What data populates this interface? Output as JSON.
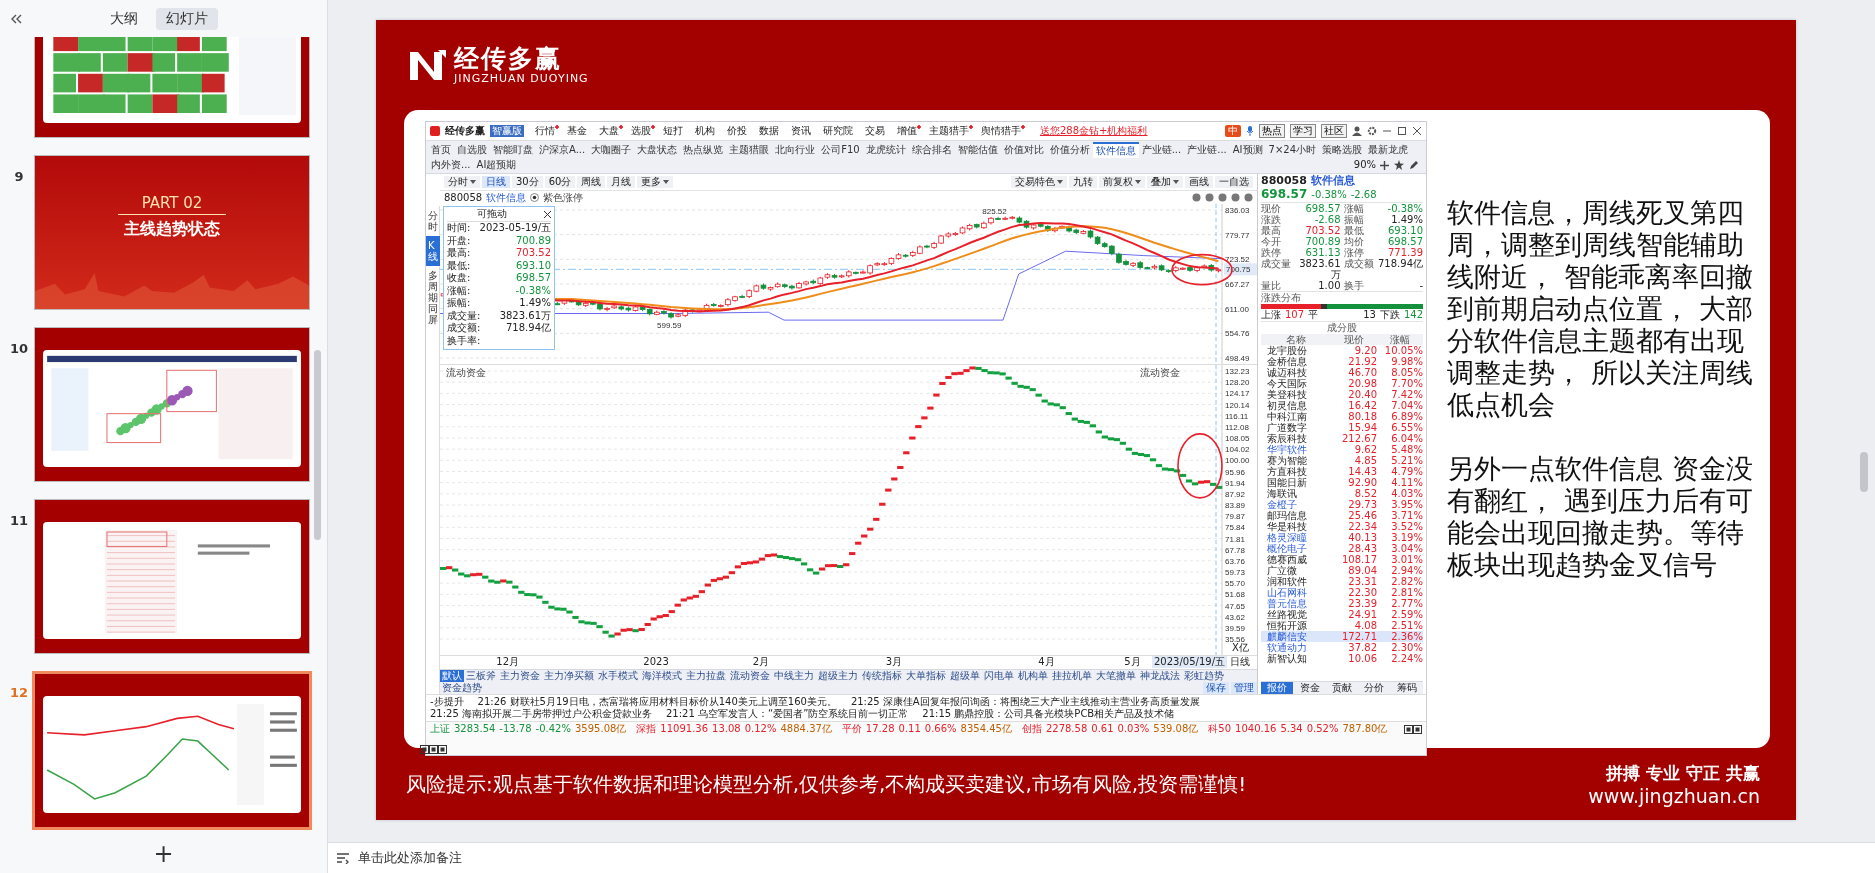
{
  "sidebar": {
    "tabs": [
      {
        "label": "大纲",
        "selected": false
      },
      {
        "label": "幻灯片",
        "selected": true
      }
    ],
    "thumbnails": [
      {
        "kind": "heatmap",
        "selected": false
      },
      {
        "number": "9",
        "kind": "title",
        "title": "PART 02",
        "subtitle": "主线趋势状态",
        "selected": false
      },
      {
        "number": "10",
        "kind": "bubble",
        "selected": false
      },
      {
        "number": "11",
        "kind": "table",
        "selected": false
      },
      {
        "number": "12",
        "kind": "chart",
        "selected": true
      }
    ],
    "add_label": "+"
  },
  "slide": {
    "brand": {
      "name": "经传多赢",
      "latin": "JINGZHUAN DUOYING"
    },
    "app": {
      "logo": "经传多赢",
      "edition": "智赢版",
      "menu": [
        {
          "label": "行情",
          "dot": true
        },
        {
          "label": "基金",
          "dot": false
        },
        {
          "label": "大盘",
          "dot": true
        },
        {
          "label": "选股",
          "dot": true
        },
        {
          "label": "短打",
          "dot": false
        },
        {
          "label": "机构",
          "dot": false
        },
        {
          "label": "价投",
          "dot": false
        },
        {
          "label": "数据",
          "dot": false
        },
        {
          "label": "资讯",
          "dot": false
        },
        {
          "label": "研究院",
          "dot": false
        },
        {
          "label": "交易",
          "dot": false
        },
        {
          "label": "增值",
          "dot": true
        },
        {
          "label": "主题猎手",
          "dot": true
        },
        {
          "label": "舆情猎手",
          "dot": true
        }
      ],
      "promo": "送您288金钻+机构福利",
      "ime_label": "中",
      "top_buttons": [
        "热点",
        "学习",
        "社区"
      ],
      "tabs": [
        {
          "label": "首页",
          "selected": false
        },
        {
          "label": "自选股",
          "selected": false
        },
        {
          "label": "智能盯盘",
          "selected": false
        },
        {
          "label": "沪深京A...",
          "selected": false
        },
        {
          "label": "大咖圈子",
          "selected": false
        },
        {
          "label": "大盘状态",
          "selected": false
        },
        {
          "label": "热点纵览",
          "selected": false
        },
        {
          "label": "主题猎眼",
          "selected": false
        },
        {
          "label": "北向行业",
          "selected": false
        },
        {
          "label": "公司F10",
          "selected": false
        },
        {
          "label": "龙虎统计",
          "selected": false
        },
        {
          "label": "综合排名",
          "selected": false
        },
        {
          "label": "智能估值",
          "selected": false
        },
        {
          "label": "价值对比",
          "selected": false
        },
        {
          "label": "价值分析",
          "selected": false
        },
        {
          "label": "软件信息",
          "selected": true
        },
        {
          "label": "产业链...",
          "selected": false
        },
        {
          "label": "产业链...",
          "selected": false
        },
        {
          "label": "AI预测",
          "selected": false
        },
        {
          "label": "7×24小时",
          "selected": false
        },
        {
          "label": "策略选股",
          "selected": false
        },
        {
          "label": "最新龙虎",
          "selected": false
        },
        {
          "label": "内外资...",
          "selected": false
        },
        {
          "label": "AI超预期",
          "selected": false
        }
      ],
      "zoom_level": "90%",
      "periods": [
        {
          "label": "分时",
          "selected": false,
          "dropdown": true
        },
        {
          "label": "日线",
          "selected": true,
          "dropdown": false
        },
        {
          "label": "30分",
          "selected": false,
          "dropdown": false
        },
        {
          "label": "60分",
          "selected": false,
          "dropdown": false
        },
        {
          "label": "周线",
          "selected": false,
          "dropdown": false
        },
        {
          "label": "月线",
          "selected": false,
          "dropdown": false
        },
        {
          "label": "更多",
          "selected": false,
          "dropdown": true
        }
      ],
      "chart_tools": [
        {
          "label": "交易特色",
          "dropdown": true
        },
        {
          "label": "九转",
          "dropdown": false
        },
        {
          "label": "前复权",
          "dropdown": true
        },
        {
          "label": "叠加",
          "dropdown": true
        },
        {
          "label": "画线",
          "dropdown": false
        },
        {
          "label": "一自选",
          "dropdown": false
        }
      ],
      "side_tabs": [
        {
          "label": "分时",
          "selected": false
        },
        {
          "label": "K线",
          "selected": true
        },
        {
          "label": "多周期同屏",
          "selected": false
        }
      ],
      "symbol": {
        "code": "880058",
        "name": "软件信息"
      },
      "overlay_option": "紫色涨停",
      "info_box": {
        "title": "可拖动",
        "rows": [
          {
            "label": "时间:",
            "value": "2023-05-19/五",
            "kind": "flat"
          },
          {
            "label": "开盘:",
            "value": "700.89",
            "kind": "down"
          },
          {
            "label": "最高:",
            "value": "703.52",
            "kind": "up"
          },
          {
            "label": "最低:",
            "value": "693.10",
            "kind": "down"
          },
          {
            "label": "收盘:",
            "value": "698.57",
            "kind": "down"
          },
          {
            "label": "涨幅:",
            "value": "-0.38%",
            "kind": "down"
          },
          {
            "label": "振幅:",
            "value": "1.49%",
            "kind": "flat"
          },
          {
            "label": "成交量:",
            "value": "3823.61万",
            "kind": "flat"
          },
          {
            "label": "成交额:",
            "value": "718.94亿",
            "kind": "flat"
          },
          {
            "label": "换手率:"
          }
        ]
      },
      "price_axis": [
        "836.03",
        "779.77",
        "723.52",
        "667.27",
        "611.00",
        "554.76",
        "498.49"
      ],
      "price_tag": "700.75",
      "high_label": "825.52",
      "low_label": "599.59",
      "flow_titles": [
        "流动资金",
        "流动资金"
      ],
      "flow_axis": [
        "132.23",
        "128.20",
        "124.17",
        "120.14",
        "116.11",
        "112.08",
        "108.05",
        "104.02",
        "100.00",
        "95.96",
        "91.94",
        "87.92",
        "83.89",
        "79.87",
        "75.84",
        "71.81",
        "67.78",
        "63.76",
        "59.73",
        "55.70",
        "51.68",
        "47.65",
        "43.62",
        "39.59",
        "35.56"
      ],
      "flow_unit": "X亿",
      "x_axis": [
        "12月",
        "2023",
        "2月",
        "3月",
        "4月",
        "5月"
      ],
      "cursor_date": "2023/05/19/五",
      "period_label": "日线",
      "indicator_tabs": [
        {
          "label": "默认",
          "selected": true
        },
        {
          "label": "三板斧",
          "selected": false
        },
        {
          "label": "主力资金",
          "selected": false
        },
        {
          "label": "主力净买额",
          "selected": false
        },
        {
          "label": "水手模式",
          "selected": false
        },
        {
          "label": "海洋模式",
          "selected": false
        },
        {
          "label": "主力拉盘",
          "selected": false
        },
        {
          "label": "流动资金",
          "selected": false
        },
        {
          "label": "中线主力",
          "selected": false
        },
        {
          "label": "超级主力",
          "selected": false
        },
        {
          "label": "传统指标",
          "selected": false
        },
        {
          "label": "大单指标",
          "selected": false
        },
        {
          "label": "超级单",
          "selected": false
        },
        {
          "label": "闪电单",
          "selected": false
        },
        {
          "label": "机构单",
          "selected": false
        },
        {
          "label": "挂拉机单",
          "selected": false
        },
        {
          "label": "大笔撤单",
          "selected": false
        },
        {
          "label": "神龙战法",
          "selected": false
        },
        {
          "label": "彩虹趋势",
          "selected": false
        },
        {
          "label": "资金趋势",
          "selected": false
        }
      ],
      "indicator_actions": [
        "保存",
        "管理"
      ],
      "quote": {
        "code": "880058",
        "name": "软件信息",
        "price": "698.57",
        "pct": "-0.38%",
        "change": "-2.68",
        "kind": "down",
        "fields": [
          {
            "label": "现价",
            "value": "698.57",
            "kind": "down"
          },
          {
            "label": "涨幅",
            "value": "-0.38%",
            "kind": "down"
          },
          {
            "label": "涨跌",
            "value": "-2.68",
            "kind": "down"
          },
          {
            "label": "振幅",
            "value": "1.49%",
            "kind": "flat"
          },
          {
            "label": "最高",
            "value": "703.52",
            "kind": "up"
          },
          {
            "label": "最低",
            "value": "693.10",
            "kind": "down"
          },
          {
            "label": "今开",
            "value": "700.89",
            "kind": "down"
          },
          {
            "label": "均价",
            "value": "698.57",
            "kind": "down"
          },
          {
            "label": "跌停",
            "value": "631.13",
            "kind": "down"
          },
          {
            "label": "涨停",
            "value": "771.39",
            "kind": "up"
          },
          {
            "label": "成交量",
            "value": "3823.61万",
            "kind": "flat"
          },
          {
            "label": "成交额",
            "value": "718.94亿",
            "kind": "flat"
          },
          {
            "label": "量比",
            "value": "1.00",
            "kind": "flat"
          },
          {
            "label": "换手",
            "value": "-",
            "kind": "flat"
          }
        ],
        "breadth": {
          "title": "涨跌分布",
          "level": 0.41,
          "up_label": "上涨",
          "up": "107",
          "flat_label": "平",
          "flat": "13",
          "down_label": "下跌",
          "down": "142"
        },
        "constituents_title": "成分股",
        "columns": [
          "名称",
          "现价",
          "涨幅"
        ],
        "stocks": [
          {
            "name": "龙宇股份",
            "price": "9.20",
            "pct": "10.05%",
            "marked": false,
            "selected": false
          },
          {
            "name": "金桥信息",
            "price": "21.92",
            "pct": "9.98%",
            "marked": false,
            "selected": false
          },
          {
            "name": "诚迈科技",
            "price": "46.70",
            "pct": "8.05%",
            "marked": false,
            "selected": false
          },
          {
            "name": "今天国际",
            "price": "20.98",
            "pct": "7.70%",
            "marked": false,
            "selected": false
          },
          {
            "name": "美登科技",
            "price": "20.40",
            "pct": "7.42%",
            "marked": false,
            "selected": false
          },
          {
            "name": "初灵信息",
            "price": "16.42",
            "pct": "7.04%",
            "marked": false,
            "selected": false
          },
          {
            "name": "中科江南",
            "price": "80.18",
            "pct": "6.89%",
            "marked": false,
            "selected": false
          },
          {
            "name": "广道数字",
            "price": "15.94",
            "pct": "6.55%",
            "marked": false,
            "selected": false
          },
          {
            "name": "索辰科技",
            "price": "212.67",
            "pct": "6.04%",
            "marked": false,
            "selected": false
          },
          {
            "name": "华宇软件",
            "price": "9.62",
            "pct": "5.48%",
            "marked": true,
            "selected": false
          },
          {
            "name": "赛为智能",
            "price": "4.85",
            "pct": "5.21%",
            "marked": false,
            "selected": false
          },
          {
            "name": "方直科技",
            "price": "14.43",
            "pct": "4.79%",
            "marked": false,
            "selected": false
          },
          {
            "name": "国能日新",
            "price": "92.90",
            "pct": "4.11%",
            "marked": false,
            "selected": false
          },
          {
            "name": "海联讯",
            "price": "8.52",
            "pct": "4.03%",
            "marked": false,
            "selected": false
          },
          {
            "name": "金橙子",
            "price": "29.73",
            "pct": "3.95%",
            "marked": true,
            "selected": false
          },
          {
            "name": "邮玛信息",
            "price": "25.46",
            "pct": "3.71%",
            "marked": false,
            "selected": false
          },
          {
            "name": "华是科技",
            "price": "22.34",
            "pct": "3.52%",
            "marked": false,
            "selected": false
          },
          {
            "name": "格灵深瞳",
            "price": "40.13",
            "pct": "3.19%",
            "marked": true,
            "selected": false
          },
          {
            "name": "概伦电子",
            "price": "28.43",
            "pct": "3.04%",
            "marked": true,
            "selected": false
          },
          {
            "name": "德赛西威",
            "price": "108.17",
            "pct": "3.01%",
            "marked": false,
            "selected": false
          },
          {
            "name": "广立微",
            "price": "89.04",
            "pct": "2.94%",
            "marked": false,
            "selected": false
          },
          {
            "name": "润和软件",
            "price": "23.31",
            "pct": "2.82%",
            "marked": false,
            "selected": false
          },
          {
            "name": "山石网科",
            "price": "22.30",
            "pct": "2.81%",
            "marked": true,
            "selected": false
          },
          {
            "name": "普元信息",
            "price": "23.39",
            "pct": "2.77%",
            "marked": true,
            "selected": false
          },
          {
            "name": "丝路视觉",
            "price": "24.91",
            "pct": "2.59%",
            "marked": false,
            "selected": false
          },
          {
            "name": "恒拓开源",
            "price": "4.08",
            "pct": "2.51%",
            "marked": false,
            "selected": false
          },
          {
            "name": "麒麟信安",
            "price": "172.71",
            "pct": "2.36%",
            "marked": true,
            "selected": true
          },
          {
            "name": "软通动力",
            "price": "37.82",
            "pct": "2.30%",
            "marked": true,
            "selected": false
          },
          {
            "name": "新智认知",
            "price": "10.06",
            "pct": "2.24%",
            "marked": false,
            "selected": false
          }
        ]
      },
      "panel_tabs": [
        {
          "label": "报价",
          "selected": true
        },
        {
          "label": "资金",
          "selected": false
        },
        {
          "label": "贡献",
          "selected": false
        },
        {
          "label": "分价",
          "selected": false
        },
        {
          "label": "筹码",
          "selected": false
        }
      ],
      "news": [
        "-步提升",
        "21:26 财联社5月19日电，杰富瑞将应用材料目标价从140美元上调至160美元。",
        "21:25 深康佳A回复年报问询函：将围绕三大产业主线推动主营业务高质量发展",
        "21:25 海南拟开展二手房带押过户公积金贷款业务",
        "21:21 乌空军发言人：“爱国者”防空系统目前一切正常",
        "21:15 鹏鼎控股：公司具备光模块PCB相关产品及技术储"
      ],
      "indices": [
        {
          "name": "上证",
          "value": "3283.54",
          "change": "-13.78",
          "pct": "-0.42%",
          "amount": "3595.08亿",
          "kind": "down"
        },
        {
          "name": "深指",
          "value": "11091.36",
          "change": "13.08",
          "pct": "0.12%",
          "amount": "4884.37亿",
          "kind": "up"
        },
        {
          "name": "平价",
          "value": "17.28",
          "change": "0.11",
          "pct": "0.66%",
          "amount": "8354.45亿",
          "kind": "up"
        },
        {
          "name": "创指",
          "value": "2278.58",
          "change": "0.61",
          "pct": "0.03%",
          "amount": "539.08亿",
          "kind": "up"
        },
        {
          "name": "科50",
          "value": "1040.16",
          "change": "5.34",
          "pct": "0.52%",
          "amount": "787.80亿",
          "kind": "up"
        }
      ]
    },
    "commentary": [
      "软件信息，周线死叉第四周，调整到周线智能辅助线附近， 智能乖离率回撤到前期启动点位置， 大部分软件信息主题都有出现调整走势， 所以关注周线低点机会",
      "另外一点软件信息 资金没有翻红， 遇到压力后有可能会出现回撤走势。等待板块出现趋势金叉信号"
    ],
    "risk_notice": "风险提示:观点基于软件数据和理论模型分析,仅供参考,不构成买卖建议,市场有风险,投资需谨慎!",
    "slogan": "拼搏 专业 守正 共赢",
    "website": "www.jingzhuan.cn"
  },
  "notes_placeholder": "单击此处添加备注"
}
